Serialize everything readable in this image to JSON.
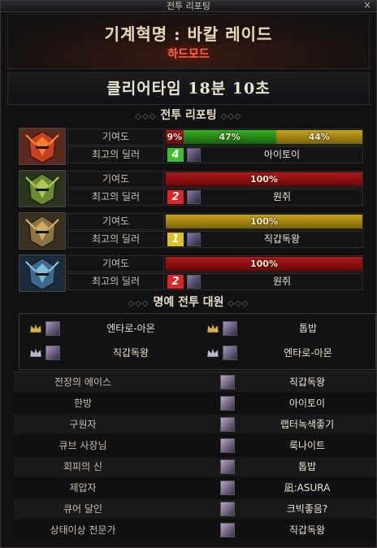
{
  "window": {
    "title": "전투 리포팅",
    "close": "×"
  },
  "header": {
    "raid_title": "기계혁명 : 바칼 레이드",
    "difficulty": "하드모드"
  },
  "clear_time": "클리어타임 18분 10초",
  "section_battle": "전투 리포팅",
  "section_honor": "명예 전투 대원",
  "ornament_left": "◇◇◇",
  "ornament_right": "◇◇◇",
  "labels": {
    "contribution": "기여도",
    "top_dealer": "최고의 딜러"
  },
  "bosses": [
    {
      "icon": "flame-helm-icon",
      "contribution": [
        {
          "color": "red",
          "percent": 9,
          "label": "9%"
        },
        {
          "color": "green",
          "percent": 47,
          "label": "47%"
        },
        {
          "color": "yellow",
          "percent": 44,
          "label": "44%"
        }
      ],
      "dealer_count": "4",
      "dealer_count_color": "#3cc02a",
      "dealer_name": "아이토이"
    },
    {
      "icon": "green-helm-icon",
      "contribution": [
        {
          "color": "red",
          "percent": 100,
          "label": "100%"
        }
      ],
      "dealer_count": "2",
      "dealer_count_color": "#e02424",
      "dealer_name": "원쥐"
    },
    {
      "icon": "gold-helm-icon",
      "contribution": [
        {
          "color": "yellow",
          "percent": 100,
          "label": "100%"
        }
      ],
      "dealer_count": "1",
      "dealer_count_color": "#e0c020",
      "dealer_name": "직갑독왕"
    },
    {
      "icon": "blue-helm-icon",
      "contribution": [
        {
          "color": "red",
          "percent": 100,
          "label": "100%"
        }
      ],
      "dealer_count": "2",
      "dealer_count_color": "#e02424",
      "dealer_name": "원쥐"
    }
  ],
  "honor": [
    {
      "crown": "gold",
      "name": "엔타로-아몬"
    },
    {
      "crown": "gold",
      "name": "톱밥"
    },
    {
      "crown": "silver",
      "name": "직갑독왕"
    },
    {
      "crown": "silver",
      "name": "엔타로-아몬"
    }
  ],
  "awards": [
    {
      "title": "전장의 에이스",
      "name": "직갑독왕"
    },
    {
      "title": "한방",
      "name": "아이토이"
    },
    {
      "title": "구원자",
      "name": "랩터녹색좋기"
    },
    {
      "title": "큐브 사장님",
      "name": "룩나이트"
    },
    {
      "title": "회피의 신",
      "name": "톱밥"
    },
    {
      "title": "제압자",
      "name": "凪:ASURA"
    },
    {
      "title": "큐어 달인",
      "name": "크빅좋음?"
    },
    {
      "title": "상태이상 전문가",
      "name": "직갑독왕"
    }
  ]
}
